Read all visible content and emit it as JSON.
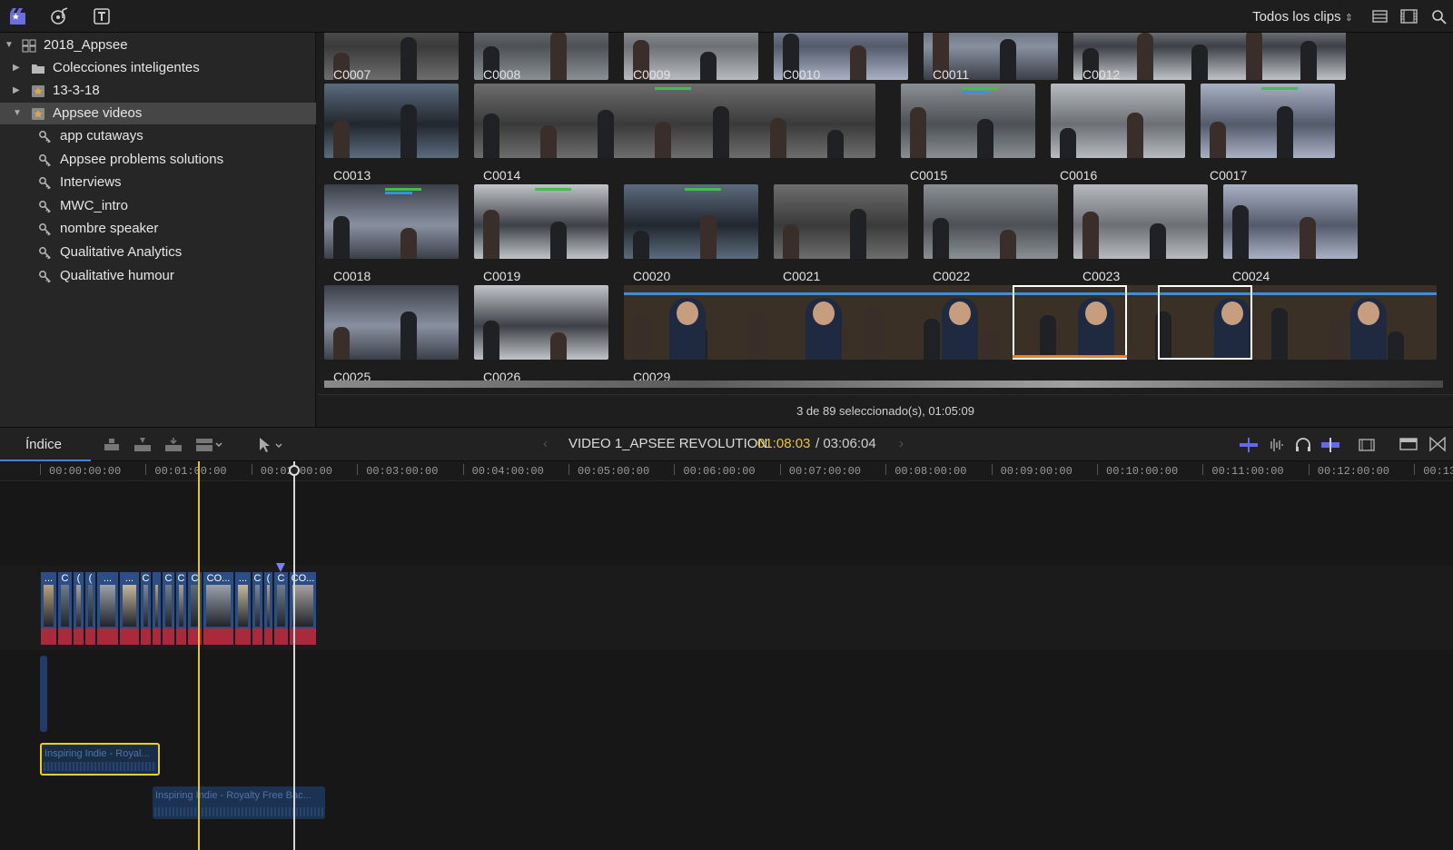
{
  "toolbar": {
    "filter_label": "Todos los clips",
    "icons": [
      "libraries-icon",
      "photos-audio-icon",
      "titles-generators-icon",
      "list-view-icon",
      "filmstrip-view-icon",
      "search-icon"
    ]
  },
  "library": {
    "root": "2018_Appsee",
    "items": [
      {
        "label": "Colecciones inteligentes",
        "kind": "folder"
      },
      {
        "label": "13-3-18",
        "kind": "event"
      },
      {
        "label": "Appsee videos",
        "kind": "event",
        "selected": true
      }
    ],
    "keywords": [
      "app cutaways",
      "Appsee problems solutions",
      "Interviews",
      "MWC_intro",
      "nombre speaker",
      "Qualitative Analytics",
      "Qualitative humour"
    ]
  },
  "browser": {
    "clips": [
      "C0007",
      "C0008",
      "C0009",
      "C0010",
      "C0011",
      "C0012",
      "C0013",
      "C0014",
      "C0015",
      "C0016",
      "C0017",
      "C0018",
      "C0019",
      "C0020",
      "C0021",
      "C0022",
      "C0023",
      "C0024",
      "C0025",
      "C0026",
      "C0029"
    ],
    "status": "3 de 89 seleccionado(s), 01:05:09"
  },
  "timeline": {
    "index_tab": "Índice",
    "project": "VIDEO 1_APSEE REVOLUTION",
    "current_tc": "01:08:03",
    "duration": "/ 03:06:04",
    "ruler": [
      "00:00:00:00",
      "00:01:00:00",
      "00:02:00:00",
      "00:03:00:00",
      "00:04:00:00",
      "00:05:00:00",
      "00:06:00:00",
      "00:07:00:00",
      "00:08:00:00",
      "00:09:00:00",
      "00:10:00:00",
      "00:11:00:00",
      "00:12:00:00",
      "00:13"
    ],
    "segments": [
      "...",
      "C",
      "(",
      "(",
      "...",
      "...",
      "C",
      "",
      "C",
      "C",
      "C",
      "CO...",
      "...",
      "C",
      "(",
      "C",
      "CO..."
    ],
    "music1": "Inspiring Indie - Royal...",
    "music2": "Inspiring Indie - Royalty Free Bac..."
  },
  "colors": {
    "accent": "#e6c12c",
    "clip_blue": "#2b4e86",
    "audio_red": "#a92a3a",
    "keyword_green": "#3fbf4c"
  }
}
